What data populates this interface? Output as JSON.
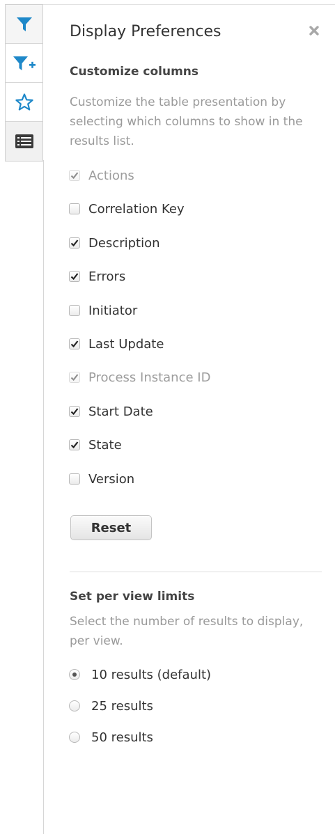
{
  "toolbar": {
    "items": [
      {
        "icon": "filter-icon",
        "color": "#1e88c9"
      },
      {
        "icon": "filter-add-icon",
        "color": "#1e88c9"
      },
      {
        "icon": "star-icon",
        "color": "#1e88c9"
      },
      {
        "icon": "list-icon",
        "color": "#3a3a3a"
      }
    ]
  },
  "panel": {
    "title": "Display Preferences",
    "close_icon": "close-icon"
  },
  "columns_section": {
    "heading": "Customize columns",
    "help": "Customize the table presentation by selecting which columns to show in the results list.",
    "options": [
      {
        "label": "Actions",
        "checked": true,
        "disabled": true
      },
      {
        "label": "Correlation Key",
        "checked": false,
        "disabled": false
      },
      {
        "label": "Description",
        "checked": true,
        "disabled": false
      },
      {
        "label": "Errors",
        "checked": true,
        "disabled": false
      },
      {
        "label": "Initiator",
        "checked": false,
        "disabled": false
      },
      {
        "label": "Last Update",
        "checked": true,
        "disabled": false
      },
      {
        "label": "Process Instance ID",
        "checked": true,
        "disabled": true
      },
      {
        "label": "Start Date",
        "checked": true,
        "disabled": false
      },
      {
        "label": "State",
        "checked": true,
        "disabled": false
      },
      {
        "label": "Version",
        "checked": false,
        "disabled": false
      }
    ],
    "reset_label": "Reset"
  },
  "limits_section": {
    "heading": "Set per view limits",
    "help": "Select the number of results to display, per view.",
    "options": [
      {
        "label": "10 results (default)",
        "selected": true
      },
      {
        "label": "25 results",
        "selected": false
      },
      {
        "label": "50 results",
        "selected": false
      }
    ]
  },
  "colors": {
    "accent": "#1e88c9",
    "text": "#333333",
    "muted": "#9a9a9a"
  }
}
